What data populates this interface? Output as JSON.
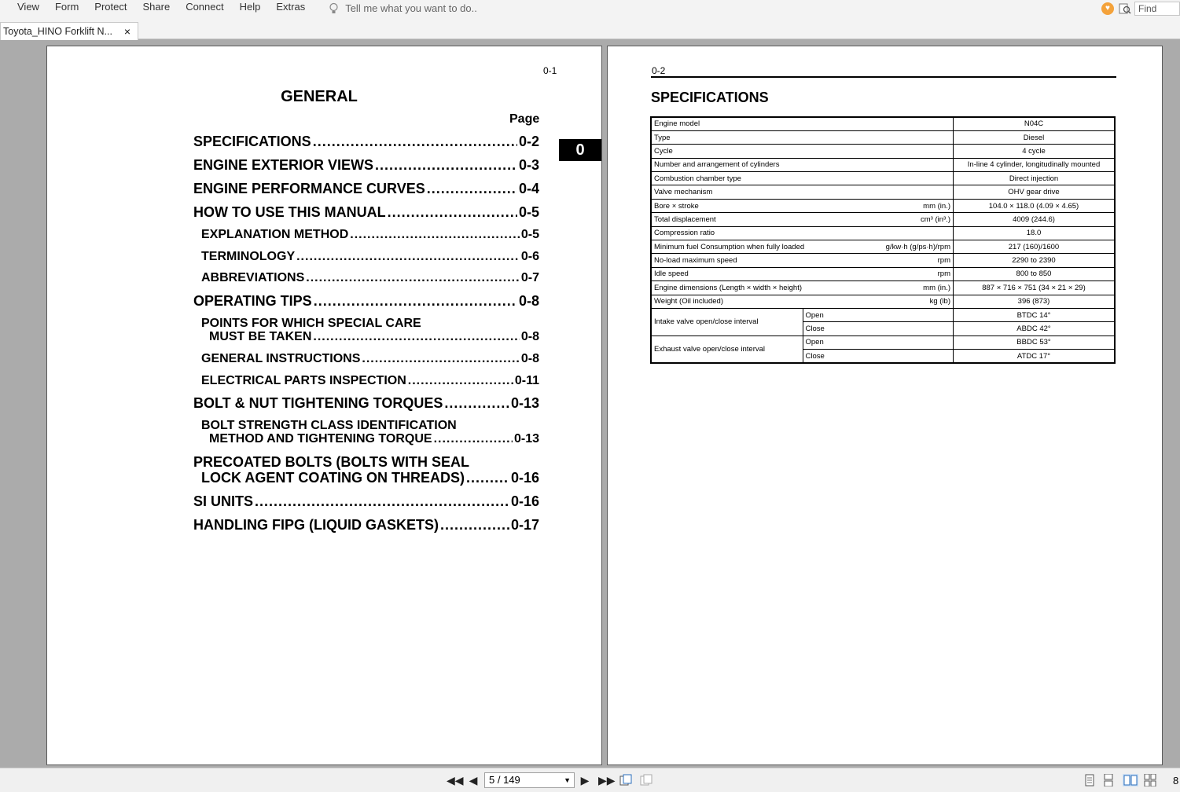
{
  "menu": {
    "items": [
      "View",
      "Form",
      "Protect",
      "Share",
      "Connect",
      "Help",
      "Extras"
    ],
    "tell_me_placeholder": "Tell me what you want to do..",
    "find_placeholder": "Find"
  },
  "tab": {
    "title": "Toyota_HINO Forklift N...",
    "close": "×"
  },
  "left_page": {
    "page_number": "0-1",
    "title": "GENERAL",
    "page_header": "Page",
    "section_tab": "0",
    "toc": [
      {
        "text": "SPECIFICATIONS",
        "page": "0-2"
      },
      {
        "text": "ENGINE EXTERIOR VIEWS",
        "page": "0-3"
      },
      {
        "text": "ENGINE PERFORMANCE CURVES",
        "page": "0-4"
      },
      {
        "text": "HOW TO USE THIS MANUAL",
        "page": "0-5"
      },
      {
        "text": "EXPLANATION METHOD",
        "page": "0-5"
      },
      {
        "text": "TERMINOLOGY",
        "page": "0-6"
      },
      {
        "text": "ABBREVIATIONS",
        "page": "0-7"
      },
      {
        "text": "OPERATING TIPS",
        "page": "0-8"
      },
      {
        "line1": "POINTS FOR WHICH SPECIAL CARE",
        "text": "MUST BE TAKEN",
        "page": "0-8"
      },
      {
        "text": "GENERAL INSTRUCTIONS",
        "page": "0-8"
      },
      {
        "text": "ELECTRICAL PARTS INSPECTION",
        "page": "0-11"
      },
      {
        "text": "BOLT & NUT TIGHTENING TORQUES",
        "page": "0-13"
      },
      {
        "line1": "BOLT STRENGTH CLASS IDENTIFICATION",
        "text": "METHOD AND TIGHTENING TORQUE",
        "page": "0-13"
      },
      {
        "line1": "PRECOATED BOLTS (BOLTS WITH SEAL",
        "text": "LOCK AGENT COATING ON THREADS)",
        "page": "0-16"
      },
      {
        "text": "SI UNITS",
        "page": "0-16"
      },
      {
        "text": "HANDLING FIPG (LIQUID GASKETS)",
        "page": "0-17"
      }
    ]
  },
  "right_page": {
    "page_number": "0-2",
    "title": "SPECIFICATIONS",
    "rows": [
      {
        "label": "Engine model",
        "unit": "",
        "value": "N04C"
      },
      {
        "label": "Type",
        "unit": "",
        "value": "Diesel"
      },
      {
        "label": "Cycle",
        "unit": "",
        "value": "4 cycle"
      },
      {
        "label": "Number and arrangement of cylinders",
        "unit": "",
        "value": "In-line 4 cylinder, longitudinally mounted"
      },
      {
        "label": "Combustion chamber type",
        "unit": "",
        "value": "Direct injection"
      },
      {
        "label": "Valve mechanism",
        "unit": "",
        "value": "OHV gear drive"
      },
      {
        "label": "Bore × stroke",
        "unit": "mm (in.)",
        "value": "104.0 × 118.0 (4.09 × 4.65)"
      },
      {
        "label": "Total displacement",
        "unit": "cm³ (in³.)",
        "value": "4009 (244.6)"
      },
      {
        "label": "Compression ratio",
        "unit": "",
        "value": "18.0"
      },
      {
        "label": "Minimum fuel Consumption when fully loaded",
        "unit": "g/kw·h (g/ps·h)/rpm",
        "value": "217 (160)/1600"
      },
      {
        "label": "No-load maximum speed",
        "unit": "rpm",
        "value": "2290 to 2390"
      },
      {
        "label": "Idle speed",
        "unit": "rpm",
        "value": "800 to 850"
      },
      {
        "label": "Engine dimensions (Length × width × height)",
        "unit": "mm (in.)",
        "value": "887 × 716 × 751 (34 × 21 × 29)"
      },
      {
        "label": "Weight (Oil included)",
        "unit": "kg (lb)",
        "value": "396 (873)"
      }
    ],
    "valve_rows": [
      {
        "label": "Intake valve open/close interval",
        "open_label": "Open",
        "open_value": "BTDC 14°",
        "close_label": "Close",
        "close_value": "ABDC 42°"
      },
      {
        "label": "Exhaust valve open/close interval",
        "open_label": "Open",
        "open_value": "BBDC 53°",
        "close_label": "Close",
        "close_value": "ATDC 17°"
      }
    ]
  },
  "nav": {
    "page_indicator": "5 / 149",
    "zoom": "8"
  }
}
